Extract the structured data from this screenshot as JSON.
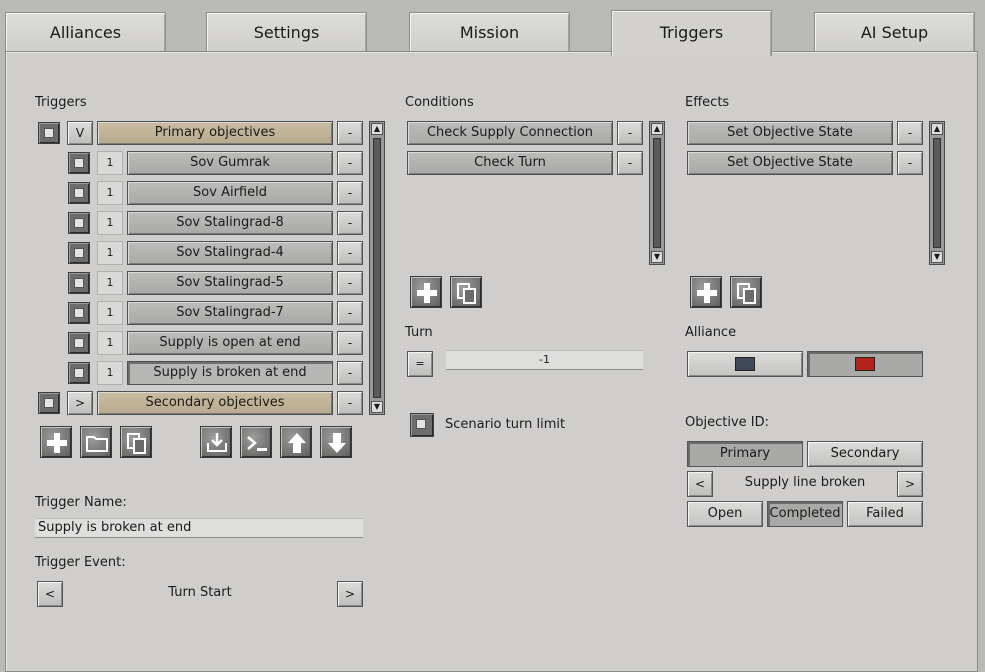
{
  "tabs": [
    "Alliances",
    "Settings",
    "Mission",
    "Triggers",
    "AI Setup"
  ],
  "active_tab": "Triggers",
  "triggers": {
    "heading": "Triggers",
    "groups": [
      {
        "toggle": "V",
        "label": "Primary objectives",
        "remove": "-"
      },
      {
        "toggle": ">",
        "label": "Secondary objectives",
        "remove": "-"
      }
    ],
    "items": [
      {
        "count": "1",
        "label": "Sov Gumrak"
      },
      {
        "count": "1",
        "label": "Sov Airfield"
      },
      {
        "count": "1",
        "label": "Sov Stalingrad-8"
      },
      {
        "count": "1",
        "label": "Sov Stalingrad-4"
      },
      {
        "count": "1",
        "label": "Sov Stalingrad-5"
      },
      {
        "count": "1",
        "label": "Sov Stalingrad-7"
      },
      {
        "count": "1",
        "label": "Supply is open at end"
      },
      {
        "count": "1",
        "label": "Supply is broken at end"
      }
    ],
    "selected_item": "Supply is broken at end",
    "remove_label": "-"
  },
  "trigger_name": {
    "label": "Trigger Name:",
    "value": "Supply is broken at end"
  },
  "trigger_event": {
    "label": "Trigger Event:",
    "value": "Turn Start",
    "prev": "<",
    "next": ">"
  },
  "conditions": {
    "heading": "Conditions",
    "items": [
      "Check Supply Connection",
      "Check Turn"
    ],
    "remove_label": "-"
  },
  "turn": {
    "label": "Turn",
    "operator": "=",
    "value": "-1"
  },
  "scenario_turn_limit": {
    "label": "Scenario turn limit"
  },
  "effects": {
    "heading": "Effects",
    "items": [
      "Set Objective State",
      "Set Objective State"
    ],
    "remove_label": "-"
  },
  "alliance": {
    "label": "Alliance",
    "colors": [
      "#3f4a58",
      "#b5231d"
    ]
  },
  "objective": {
    "label": "Objective ID:",
    "types": [
      "Primary",
      "Secondary"
    ],
    "active_type": "Primary",
    "prev": "<",
    "next": ">",
    "name": "Supply line broken",
    "states": [
      "Open",
      "Completed",
      "Failed"
    ],
    "active_state": "Completed"
  }
}
